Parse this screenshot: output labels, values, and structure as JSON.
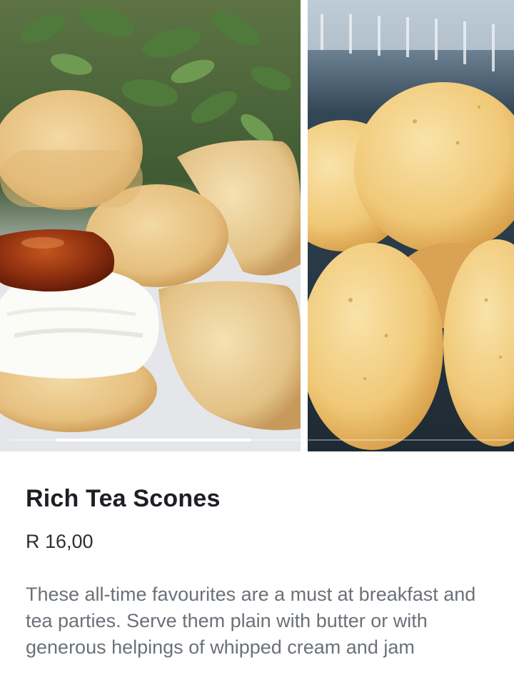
{
  "gallery": {
    "images": [
      {
        "icon": "scones-with-cream-and-jam-photo"
      },
      {
        "icon": "scones-in-container-photo"
      }
    ]
  },
  "product": {
    "title": "Rich Tea Scones",
    "price": "R 16,00",
    "description": "These all-time favourites are a must at breakfast and tea parties. Serve them plain with butter or with generous helpings of whipped cream and jam"
  },
  "colors": {
    "title": "#1c1f24",
    "price": "#2b2f34",
    "description": "#6b7178",
    "background": "#ffffff"
  }
}
